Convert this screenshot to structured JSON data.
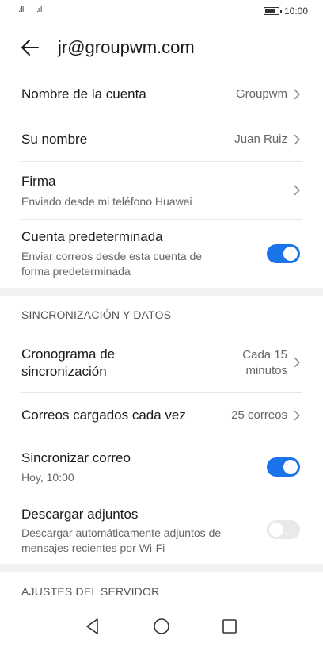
{
  "status": {
    "signal1": ".ıll",
    "signal2": ".ıll",
    "time": "10:00"
  },
  "header": {
    "title": "jr@groupwm.com"
  },
  "account": {
    "name": {
      "label": "Nombre de la cuenta",
      "value": "Groupwm"
    },
    "your_name": {
      "label": "Su nombre",
      "value": "Juan Ruiz"
    },
    "signature": {
      "label": "Firma",
      "value": "Enviado desde mi teléfono Huawei"
    },
    "default": {
      "label": "Cuenta predeterminada",
      "line1": "Enviar correos desde esta cuenta de",
      "line2": "forma predeterminada",
      "enabled": true
    }
  },
  "sync": {
    "section_title": "SINCRONIZACIÓN Y DATOS",
    "schedule": {
      "label_line1": "Cronograma de",
      "label_line2": "sincronización",
      "value_line1": "Cada 15",
      "value_line2": "minutos"
    },
    "loaded": {
      "label": "Correos cargados cada vez",
      "value": "25 correos"
    },
    "sync_mail": {
      "label": "Sincronizar correo",
      "value": "Hoy, 10:00",
      "enabled": true
    },
    "attachments": {
      "label": "Descargar adjuntos",
      "line1": "Descargar automáticamente adjuntos de",
      "line2": "mensajes recientes por Wi-Fi",
      "enabled": false
    }
  },
  "server": {
    "section_title": "AJUSTES DEL SERVIDOR"
  },
  "icons": {
    "back": "arrow-left-icon",
    "chevron": "chevron-right-icon",
    "nav_back": "triangle-back-icon",
    "nav_home": "circle-home-icon",
    "nav_recent": "square-recents-icon"
  },
  "colors": {
    "accent": "#1a73e8",
    "toggle_off": "#e9e9e9"
  }
}
